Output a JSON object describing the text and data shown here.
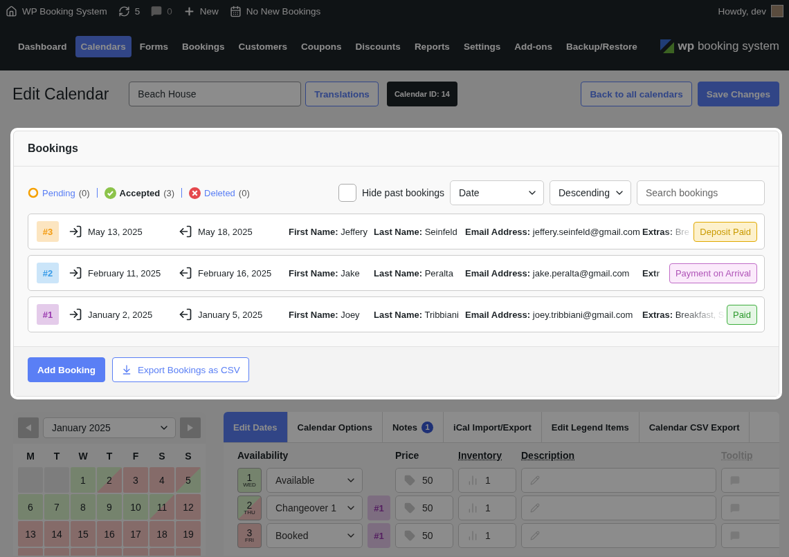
{
  "admin_bar": {
    "site": "WP Booking System",
    "updates": "5",
    "comments": "0",
    "new": "New",
    "bookings": "No New Bookings",
    "greeting": "Howdy, dev"
  },
  "nav": {
    "items": [
      {
        "label": "Dashboard",
        "selected": false
      },
      {
        "label": "Calendars",
        "selected": true
      },
      {
        "label": "Forms",
        "selected": false
      },
      {
        "label": "Bookings",
        "selected": false
      },
      {
        "label": "Customers",
        "selected": false
      },
      {
        "label": "Coupons",
        "selected": false
      },
      {
        "label": "Discounts",
        "selected": false
      },
      {
        "label": "Reports",
        "selected": false
      },
      {
        "label": "Settings",
        "selected": false
      },
      {
        "label": "Add-ons",
        "selected": false
      },
      {
        "label": "Backup/Restore",
        "selected": false
      }
    ],
    "logo": "**wp** booking system"
  },
  "header": {
    "title": "Edit Calendar",
    "name": "Beach House",
    "translations": "Translations",
    "calendar_id": "Calendar ID: 14",
    "back": "Back to all calendars",
    "save": "Save Changes"
  },
  "bookings_panel": {
    "title": "Bookings",
    "filters": [
      {
        "kind": "pending",
        "label": "Pending",
        "count": "(0)",
        "selected": false
      },
      {
        "kind": "accepted",
        "label": "Accepted",
        "count": "(3)",
        "selected": true
      },
      {
        "kind": "deleted",
        "label": "Deleted",
        "count": "(0)",
        "selected": false
      }
    ],
    "hide_past": {
      "label": "Hide past bookings",
      "checked": false
    },
    "sort": "Date",
    "order": "Descending",
    "search": {
      "placeholder": "Search bookings"
    },
    "bookings": [
      {
        "id": "#3",
        "color": "#f39c12",
        "start": "May 13, 2025",
        "end": "May 18, 2025",
        "first_name_label": "First Name:",
        "first_name": "Jeffery",
        "last_name_label": "Last Name:",
        "last_name": "Seinfeld",
        "email_label": "Email Address:",
        "email": "jeffery.seinfeld@gmail.com",
        "extras_label": "Extras:",
        "extras": "Bre",
        "status": {
          "kind": "deposit",
          "label": "Deposit Paid"
        }
      },
      {
        "id": "#2",
        "color": "#3b9de8",
        "start": "February 11, 2025",
        "end": "February 16, 2025",
        "first_name_label": "First Name:",
        "first_name": "Jake",
        "last_name_label": "Last Name:",
        "last_name": "Peralta",
        "email_label": "Email Address:",
        "email": "jake.peralta@gmail.com",
        "extras_label": "Extr",
        "status": {
          "kind": "arrival",
          "label": "Payment on Arrival"
        }
      },
      {
        "id": "#1",
        "color": "#9b3bb0",
        "start": "January 2, 2025",
        "end": "January 5, 2025",
        "first_name_label": "First Name:",
        "first_name": "Joey",
        "last_name_label": "Last Name:",
        "last_name": "Tribbiani",
        "email_label": "Email Address:",
        "email": "joey.tribbiani@gmail.com",
        "extras_label": "Extras:",
        "extras": "Breakfast, S",
        "status": {
          "kind": "paid",
          "label": "Paid"
        }
      }
    ],
    "add_button": "Add Booking",
    "export_button": "Export Bookings as CSV"
  },
  "calendar": {
    "month": "January 2025",
    "weekdays": [
      "M",
      "T",
      "W",
      "T",
      "F",
      "S",
      "S"
    ],
    "days": [
      {
        "kind": "empty"
      },
      {
        "kind": "empty"
      },
      {
        "day": "1",
        "kind": "available"
      },
      {
        "day": "2",
        "kind": "changeover"
      },
      {
        "day": "3",
        "kind": "booked"
      },
      {
        "day": "4",
        "kind": "booked"
      },
      {
        "day": "5",
        "kind": "turnover"
      },
      {
        "day": "6",
        "kind": "available"
      },
      {
        "day": "7",
        "kind": "available"
      },
      {
        "day": "8",
        "kind": "available"
      },
      {
        "day": "9",
        "kind": "available"
      },
      {
        "day": "10",
        "kind": "available"
      },
      {
        "day": "11",
        "kind": "changeover"
      },
      {
        "day": "12",
        "kind": "booked"
      },
      {
        "day": "13",
        "kind": "booked"
      },
      {
        "day": "14",
        "kind": "booked"
      },
      {
        "day": "15",
        "kind": "booked"
      },
      {
        "day": "16",
        "kind": "booked"
      },
      {
        "day": "17",
        "kind": "booked"
      },
      {
        "day": "18",
        "kind": "booked"
      },
      {
        "day": "19",
        "kind": "booked"
      },
      {
        "kind": "booked"
      },
      {
        "kind": "booked"
      },
      {
        "kind": "booked"
      },
      {
        "kind": "booked"
      },
      {
        "kind": "booked"
      },
      {
        "kind": "booked"
      },
      {
        "kind": "booked"
      }
    ]
  },
  "editor": {
    "tabs": [
      {
        "label": "Edit Dates",
        "selected": true
      },
      {
        "label": "Calendar Options",
        "selected": false
      },
      {
        "label": "Notes",
        "badge": "1",
        "selected": false
      },
      {
        "label": "iCal Import/Export",
        "selected": false
      },
      {
        "label": "Edit Legend Items",
        "selected": false
      },
      {
        "label": "Calendar CSV Export",
        "selected": false
      }
    ],
    "columns": {
      "availability": "Availability",
      "price": "Price",
      "inventory": "Inventory",
      "description": "Description",
      "tooltip": "Tooltip"
    },
    "rows": [
      {
        "day": "1",
        "weekday": "WED",
        "kind": "available",
        "availability": "Available",
        "price": "50",
        "inventory": "1"
      },
      {
        "day": "2",
        "weekday": "THU",
        "kind": "changeover",
        "availability": "Changeover 1",
        "booking": "#1",
        "price": "50",
        "inventory": "1"
      },
      {
        "day": "3",
        "weekday": "FRI",
        "kind": "booked",
        "availability": "Booked",
        "booking": "#1",
        "price": "50",
        "inventory": "1"
      }
    ]
  }
}
